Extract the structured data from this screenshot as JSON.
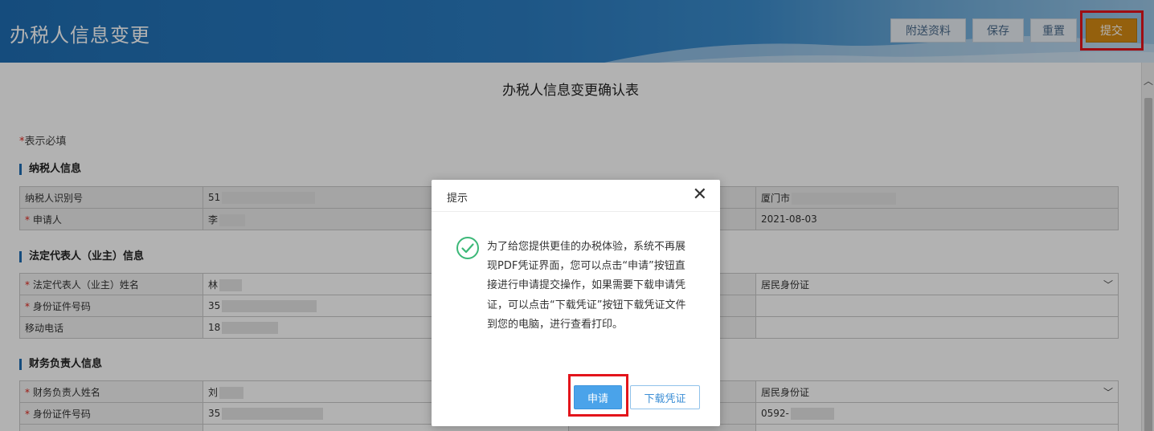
{
  "header": {
    "title": "办税人信息变更",
    "buttons": {
      "attach": "附送资料",
      "save": "保存",
      "reset": "重置",
      "submit": "提交"
    }
  },
  "document": {
    "title": "办税人信息变更确认表",
    "required_note_star": "*",
    "required_note": "表示必填"
  },
  "sections": {
    "taxpayer": {
      "title": "纳税人信息",
      "rows": [
        {
          "label": "纳税人识别号",
          "value": "51",
          "right_value": "厦门市"
        },
        {
          "label": "申请人",
          "required": "*",
          "value": "李",
          "right_value": "2021-08-03"
        }
      ]
    },
    "legal_rep": {
      "title": "法定代表人（业主）信息",
      "rows": [
        {
          "label": "法定代表人（业主）姓名",
          "required": "*",
          "value": "林",
          "right_value": "居民身份证"
        },
        {
          "label": "身份证件号码",
          "required": "*",
          "value": "35"
        },
        {
          "label": "移动电话",
          "value": "18"
        }
      ]
    },
    "finance": {
      "title": "财务负责人信息",
      "rows": [
        {
          "label": "财务负责人姓名",
          "required": "*",
          "value": "刘",
          "right_value": "居民身份证"
        },
        {
          "label": "身份证件号码",
          "required": "*",
          "value": "35",
          "right_value": "0592-"
        }
      ]
    }
  },
  "modal": {
    "title": "提示",
    "close": "✕",
    "message": "为了给您提供更佳的办税体验，系统不再展现PDF凭证界面，您可以点击“申请”按钮直接进行申请提交操作，如果需要下载申请凭证，可以点击“下载凭证”按钮下载凭证文件到您的电脑，进行查看打印。",
    "apply_label": "申请",
    "download_label": "下载凭证"
  },
  "icons": {
    "dropdown": "chevron-down-icon",
    "success": "check-circle-icon",
    "scroll": "scroll-up-icon"
  },
  "colors": {
    "header_blue": "#1f6eb3",
    "submit_orange": "#d58a14",
    "highlight_red": "#e3141b",
    "apply_blue": "#4aa3ea",
    "success_green": "#3cb878"
  }
}
